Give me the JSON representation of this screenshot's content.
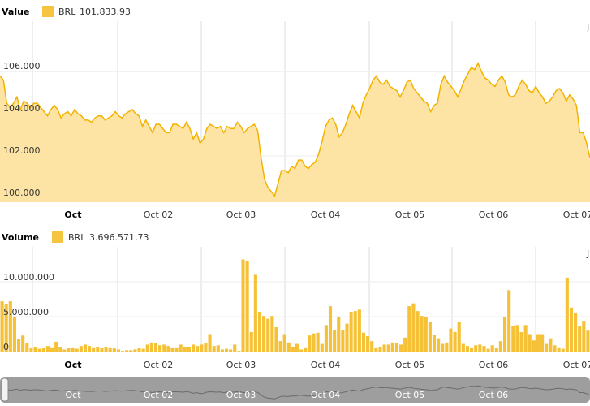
{
  "colors": {
    "accent": "#f5c542",
    "area_fill": "#fde4a4",
    "line": "#f2b300",
    "bar": "#f5c136",
    "grid": "#dddddd",
    "navigator_bg": "#9e9e9e"
  },
  "price_panel": {
    "header_label": "Value",
    "series_name": "BRL",
    "value_text": "101.833,93",
    "yticks": [
      "100.000",
      "102.000",
      "104.000",
      "106.000"
    ],
    "ytick_values": [
      100000,
      102000,
      104000,
      106000
    ],
    "ylim": [
      99800,
      108400
    ],
    "corner_label": "J"
  },
  "volume_panel": {
    "header_label": "Volume",
    "series_name": "BRL",
    "value_text": "3.696.571,73",
    "yticks": [
      "0",
      "5.000.000",
      "10.000.000"
    ],
    "ytick_values": [
      0,
      5000000,
      10000000
    ],
    "ylim": [
      0,
      15000000
    ],
    "corner_label": "J"
  },
  "x_axis": {
    "labels": [
      "Oct",
      "Oct 02",
      "Oct 03",
      "Oct 04",
      "Oct 05",
      "Oct 06",
      "Oct 07"
    ],
    "bold_index": 0
  },
  "navigator": {
    "labels": [
      "Oct",
      "Oct 02",
      "Oct 03",
      "Oct 04",
      "Oct 05",
      "Oct 06"
    ]
  },
  "chart_data": [
    {
      "type": "area",
      "title": "",
      "series": [
        {
          "name": "BRL",
          "values": [
            105800,
            105600,
            104500,
            104300,
            104500,
            104800,
            104200,
            104600,
            104500,
            104300,
            104500,
            104500,
            104300,
            104100,
            103900,
            104200,
            104400,
            104200,
            103800,
            104000,
            104100,
            103900,
            104200,
            104000,
            103900,
            103700,
            103700,
            103600,
            103800,
            103900,
            103900,
            103700,
            103800,
            103900,
            104100,
            103900,
            103800,
            104000,
            104100,
            104200,
            104000,
            103900,
            103400,
            103700,
            103400,
            103100,
            103500,
            103500,
            103300,
            103100,
            103100,
            103500,
            103500,
            103400,
            103300,
            103600,
            103300,
            102800,
            103100,
            102600,
            102800,
            103300,
            103500,
            103400,
            103300,
            103400,
            103100,
            103400,
            103300,
            103300,
            103600,
            103400,
            103100,
            103300,
            103400,
            103500,
            103200,
            101900,
            100900,
            100500,
            100300,
            100100,
            100700,
            101300,
            101300,
            101200,
            101500,
            101400,
            101800,
            101800,
            101500,
            101400,
            101600,
            101700,
            102100,
            102700,
            103400,
            103700,
            103800,
            103500,
            102900,
            103100,
            103500,
            104000,
            104400,
            104100,
            103800,
            104500,
            104900,
            105200,
            105600,
            105800,
            105500,
            105400,
            105600,
            105300,
            105200,
            105100,
            104800,
            105100,
            105500,
            105600,
            105200,
            105000,
            104800,
            104600,
            104500,
            104100,
            104400,
            104500,
            105400,
            105800,
            105500,
            105300,
            105100,
            104800,
            105200,
            105600,
            105900,
            106200,
            106100,
            106400,
            106000,
            105700,
            105600,
            105400,
            105300,
            105600,
            105800,
            105500,
            104900,
            104800,
            104900,
            105300,
            105600,
            105400,
            105100,
            105000,
            105300,
            105000,
            104800,
            104500,
            104600,
            104800,
            105100,
            105200,
            105000,
            104600,
            104900,
            104700,
            104400,
            103100,
            103100,
            102600,
            101900
          ]
        }
      ],
      "ylim": [
        99800,
        108400
      ],
      "ticks": [
        "100.000",
        "102.000",
        "104.000",
        "106.000"
      ]
    },
    {
      "type": "bar",
      "title": "",
      "series": [
        {
          "name": "BRL",
          "values": [
            7200000,
            6800000,
            7200000,
            5000000,
            1800000,
            2300000,
            1200000,
            500000,
            700000,
            400000,
            500000,
            800000,
            600000,
            1400000,
            700000,
            300000,
            500000,
            600000,
            400000,
            800000,
            1000000,
            800000,
            600000,
            700000,
            500000,
            700000,
            600000,
            500000,
            300000,
            100000,
            200000,
            200000,
            300000,
            500000,
            400000,
            1000000,
            1300000,
            1200000,
            900000,
            1000000,
            800000,
            600000,
            600000,
            1000000,
            700000,
            700000,
            1000000,
            800000,
            1000000,
            1200000,
            2500000,
            800000,
            900000,
            300000,
            400000,
            300000,
            1000000,
            100000,
            13200000,
            13000000,
            2800000,
            11000000,
            5700000,
            5100000,
            4700000,
            5100000,
            3500000,
            1500000,
            2500000,
            1300000,
            700000,
            1100000,
            300000,
            600000,
            2300000,
            2600000,
            2700000,
            1100000,
            3800000,
            6500000,
            3100000,
            5000000,
            3100000,
            4000000,
            5700000,
            5800000,
            6000000,
            2700000,
            2200000,
            1500000,
            600000,
            700000,
            1000000,
            1000000,
            1300000,
            1200000,
            1000000,
            2000000,
            6500000,
            6900000,
            5800000,
            5100000,
            4900000,
            4200000,
            2400000,
            1900000,
            1100000,
            1300000,
            3300000,
            2800000,
            4200000,
            1100000,
            800000,
            600000,
            900000,
            1000000,
            800000,
            400000,
            900000,
            500000,
            1500000,
            4900000,
            8800000,
            3700000,
            3800000,
            2800000,
            3800000,
            2500000,
            1600000,
            2500000,
            2500000,
            1100000,
            1900000,
            900000,
            600000,
            400000,
            10600000,
            6300000,
            5500000,
            3600000,
            4400000,
            3000000
          ]
        }
      ],
      "ylim": [
        0,
        15000000
      ],
      "ticks": [
        "0",
        "5.000.000",
        "10.000.000"
      ]
    }
  ]
}
